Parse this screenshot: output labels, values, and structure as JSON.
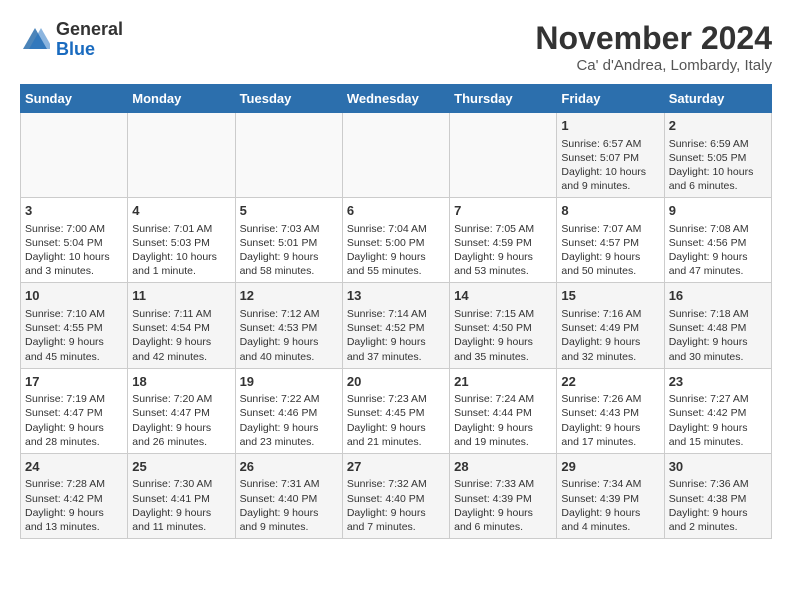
{
  "header": {
    "logo_line1": "General",
    "logo_line2": "Blue",
    "month_year": "November 2024",
    "location": "Ca' d'Andrea, Lombardy, Italy"
  },
  "weekdays": [
    "Sunday",
    "Monday",
    "Tuesday",
    "Wednesday",
    "Thursday",
    "Friday",
    "Saturday"
  ],
  "weeks": [
    [
      {
        "day": "",
        "info": ""
      },
      {
        "day": "",
        "info": ""
      },
      {
        "day": "",
        "info": ""
      },
      {
        "day": "",
        "info": ""
      },
      {
        "day": "",
        "info": ""
      },
      {
        "day": "1",
        "info": "Sunrise: 6:57 AM\nSunset: 5:07 PM\nDaylight: 10 hours\nand 9 minutes."
      },
      {
        "day": "2",
        "info": "Sunrise: 6:59 AM\nSunset: 5:05 PM\nDaylight: 10 hours\nand 6 minutes."
      }
    ],
    [
      {
        "day": "3",
        "info": "Sunrise: 7:00 AM\nSunset: 5:04 PM\nDaylight: 10 hours\nand 3 minutes."
      },
      {
        "day": "4",
        "info": "Sunrise: 7:01 AM\nSunset: 5:03 PM\nDaylight: 10 hours\nand 1 minute."
      },
      {
        "day": "5",
        "info": "Sunrise: 7:03 AM\nSunset: 5:01 PM\nDaylight: 9 hours\nand 58 minutes."
      },
      {
        "day": "6",
        "info": "Sunrise: 7:04 AM\nSunset: 5:00 PM\nDaylight: 9 hours\nand 55 minutes."
      },
      {
        "day": "7",
        "info": "Sunrise: 7:05 AM\nSunset: 4:59 PM\nDaylight: 9 hours\nand 53 minutes."
      },
      {
        "day": "8",
        "info": "Sunrise: 7:07 AM\nSunset: 4:57 PM\nDaylight: 9 hours\nand 50 minutes."
      },
      {
        "day": "9",
        "info": "Sunrise: 7:08 AM\nSunset: 4:56 PM\nDaylight: 9 hours\nand 47 minutes."
      }
    ],
    [
      {
        "day": "10",
        "info": "Sunrise: 7:10 AM\nSunset: 4:55 PM\nDaylight: 9 hours\nand 45 minutes."
      },
      {
        "day": "11",
        "info": "Sunrise: 7:11 AM\nSunset: 4:54 PM\nDaylight: 9 hours\nand 42 minutes."
      },
      {
        "day": "12",
        "info": "Sunrise: 7:12 AM\nSunset: 4:53 PM\nDaylight: 9 hours\nand 40 minutes."
      },
      {
        "day": "13",
        "info": "Sunrise: 7:14 AM\nSunset: 4:52 PM\nDaylight: 9 hours\nand 37 minutes."
      },
      {
        "day": "14",
        "info": "Sunrise: 7:15 AM\nSunset: 4:50 PM\nDaylight: 9 hours\nand 35 minutes."
      },
      {
        "day": "15",
        "info": "Sunrise: 7:16 AM\nSunset: 4:49 PM\nDaylight: 9 hours\nand 32 minutes."
      },
      {
        "day": "16",
        "info": "Sunrise: 7:18 AM\nSunset: 4:48 PM\nDaylight: 9 hours\nand 30 minutes."
      }
    ],
    [
      {
        "day": "17",
        "info": "Sunrise: 7:19 AM\nSunset: 4:47 PM\nDaylight: 9 hours\nand 28 minutes."
      },
      {
        "day": "18",
        "info": "Sunrise: 7:20 AM\nSunset: 4:47 PM\nDaylight: 9 hours\nand 26 minutes."
      },
      {
        "day": "19",
        "info": "Sunrise: 7:22 AM\nSunset: 4:46 PM\nDaylight: 9 hours\nand 23 minutes."
      },
      {
        "day": "20",
        "info": "Sunrise: 7:23 AM\nSunset: 4:45 PM\nDaylight: 9 hours\nand 21 minutes."
      },
      {
        "day": "21",
        "info": "Sunrise: 7:24 AM\nSunset: 4:44 PM\nDaylight: 9 hours\nand 19 minutes."
      },
      {
        "day": "22",
        "info": "Sunrise: 7:26 AM\nSunset: 4:43 PM\nDaylight: 9 hours\nand 17 minutes."
      },
      {
        "day": "23",
        "info": "Sunrise: 7:27 AM\nSunset: 4:42 PM\nDaylight: 9 hours\nand 15 minutes."
      }
    ],
    [
      {
        "day": "24",
        "info": "Sunrise: 7:28 AM\nSunset: 4:42 PM\nDaylight: 9 hours\nand 13 minutes."
      },
      {
        "day": "25",
        "info": "Sunrise: 7:30 AM\nSunset: 4:41 PM\nDaylight: 9 hours\nand 11 minutes."
      },
      {
        "day": "26",
        "info": "Sunrise: 7:31 AM\nSunset: 4:40 PM\nDaylight: 9 hours\nand 9 minutes."
      },
      {
        "day": "27",
        "info": "Sunrise: 7:32 AM\nSunset: 4:40 PM\nDaylight: 9 hours\nand 7 minutes."
      },
      {
        "day": "28",
        "info": "Sunrise: 7:33 AM\nSunset: 4:39 PM\nDaylight: 9 hours\nand 6 minutes."
      },
      {
        "day": "29",
        "info": "Sunrise: 7:34 AM\nSunset: 4:39 PM\nDaylight: 9 hours\nand 4 minutes."
      },
      {
        "day": "30",
        "info": "Sunrise: 7:36 AM\nSunset: 4:38 PM\nDaylight: 9 hours\nand 2 minutes."
      }
    ]
  ]
}
